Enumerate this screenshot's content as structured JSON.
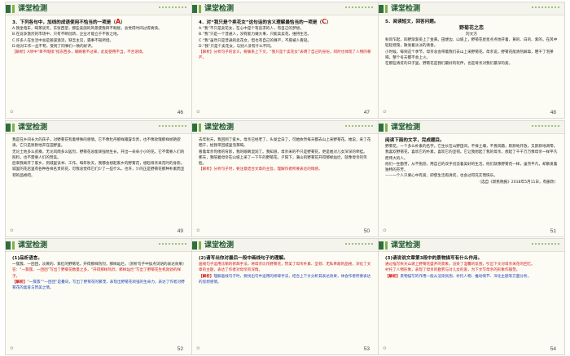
{
  "slides": [
    {
      "header": "课堂检测",
      "page": "46",
      "question": "3．下列各句中，加线的成语使用不恰当的一项是（",
      "answer": "A",
      "answer_close": "）",
      "lines": [
        "A.我坐电车，喝茶谈笑，东张西望，那些美丽的风景使我目不暇接，总觉得时间过得真快。",
        "B.在竞争激烈的市场中，只有不断创新，企业才能立于不败之地。",
        "C.许多人在生活中总是随波逐流，缺乏主见，遇事不知所措。",
        "D.他对工作一丝不苟，受到了同事们一致的好评。"
      ],
      "analysis_label": "【解析】",
      "analysis": "A项中“目不暇接”指东西多，眼睛看不过来，此处使用不当，不合语境。"
    },
    {
      "header": "课堂检测",
      "page": "47",
      "question": "4．对“我只是个卖花女”这句话的含义理解最恰当的一项是（",
      "answer": "C",
      "answer_close": "）",
      "lines": [
        "A.“我”不只是卖花女，在心中是个有追求的人，有自己的梦想。",
        "B.“我”只是一个普通人，没有能力做大事，只能卖卖花，维持生活。",
        "C.“我”虽然只是普通的卖花女，但也有自己的尊严，不愿被人看轻。",
        "D.“我”只是个卖花女，与别人没有什么不同。"
      ],
      "analysis_label": "【解析】",
      "analysis": "分析句子的含义，要联系上下文，“我只是个卖花女”表明了自己的身份，同时也体现了人物的尊严。"
    },
    {
      "header": "课堂检测",
      "page": "48",
      "question": "5．阅读短文，回答问题。",
      "story_title": "野菊花之恋",
      "story_author": "刘文方",
      "lines": [
        "秋风乍起，四野渐渐染上了金黄。田埂边、山坡上，野菊花星星点点地开着，黄的、白的、紫的，在风中轻轻摇曳，散发着淡淡的清香。",
        "小时候，每到这个季节，母亲总会带着我们去山上采野菊花。母亲说，野菊花能清热解毒，晒干了泡茶喝，整个冬天都不会上火。",
        "在那些清贫的日子里，野菊花是我们最好的玩伴，也是母亲对我们最深的爱。"
      ]
    },
    {
      "header": "课堂检测",
      "page": "49",
      "lines": [
        "我是在乡间长大的孩子，对野菊花有着特殊的感情。它不像牡丹那样雍容华贵，也不像玫瑰那样娇艳欲滴，它只是默默地开在田野里。",
        "无论土地多么贫瘠，无论风雨多么猛烈，野菊花总能顽强地生长，开出一朵朵小小的花。它不需要人们的照料，也不需要人们的赞美。",
        "后来我离开了家乡，到城里读书、工作。每年秋天，我都会想起家乡的野菊花，想起母亲采花时的身影。",
        "城里的花店里有各种各样名贵的花，可我总觉得它们少了一些什么。也许，少的正是野菊花那种朴素而坚韧的品格吧。"
      ]
    },
    {
      "header": "课堂检测",
      "page": "50",
      "lines": [
        "去年秋天，我回到了家乡。母亲已经老了，头发全白了，可她依然每天都去山上采野菊花。她说，采了花晒干，给我带回城里泡茶喝。",
        "看着母亲佝偻的背影，我的眼睛湿润了。我知道，母亲采的不只是野菊花，更是她对儿女深深的牵挂。",
        "那天，我陪着母亲在山坡上采了一下午的野菊花。夕阳下，满山的野菊花开得那样灿烂，就像母亲的笑脸。"
      ],
      "analysis_label": "【解析】",
      "analysis": "分析句子时，要注意结合文章的主旨，理解作者所要表达的情感。"
    },
    {
      "header": "课堂检测",
      "page": "51",
      "heading": "阅读下面的文字，完成题目。",
      "lines": [
        "野菊花，一个多么朴素的名字。它生长在山野田间，不择土壤，不畏风霜，默默地开放，又默默地凋零。",
        "我喜欢野菊花，喜欢它的朴素，喜欢它的坚韧。它让我想起了我的母亲，想起了千千万万像母亲一样平凡而伟大的人。",
        "他们一生勤劳，从不抱怨，用自己的双手创造着美好的生活。他们就像野菊花一样，虽然平凡，却散发着独特的芬芳。",
        "——一个人只要心中有爱，即使生活再清贫，也会过得充实而快乐。"
      ],
      "source": "（选自《新民晚报》2018年5月11日，有删改）"
    },
    {
      "header": "课堂检测",
      "page": "52",
      "heading": "(1)品析语言。",
      "lines": [
        "一簇簇、一团团，淡黄的、紫红的野菊花，开得那样热烈，那样灿烂。（赏析句子中加点词语的表达效果）",
        "答：“一簇簇、一团团”写出了野菊花数量之多，“开得那样热烈，那样灿烂”写出了野菊花生机勃勃的样子。"
      ],
      "analysis_label": "【解析】",
      "analysis": "“一簇簇”“一团团”是叠词，写出了野菊花的繁茂，表现出野菊花顽强的生命力，表达了作者对野菊花的喜爱与赞美之情。"
    },
    {
      "header": "课堂检测",
      "page": "53",
      "heading": "(2)请写出你对最后一段中画线句子的理解。",
      "lines": [
        "画线句子运用比喻的修辞手法，将母亲比作野菊花，赞美了母亲朴素、坚韧、无私奉献的品格，深化了文章的主题，表达了作者对母亲的深情。"
      ],
      "analysis_label": "【解析】",
      "analysis": "理解画线句子时，要找出句中运用的修辞手法，结合上下文分析其表达效果，体会作者所要表达的思想感情。"
    },
    {
      "header": "课堂检测",
      "page": "54",
      "heading": "(3)请说说文章第3段中的景物描写有什么作用。",
      "lines": [
        "通过描写秋天山坡上野菊花盛开的景象，渲染了温馨的氛围，引出下文对母亲采花的回忆。",
        "衬托了人物形象，表现了母亲的勤劳与对儿女的爱，为下文写母亲的形象作铺垫。"
      ],
      "analysis_label": "【解析】",
      "analysis": "景物描写的作用一般从渲染氛围、衬托人物、推动情节、深化主题等方面分析。"
    }
  ],
  "colors": {
    "accent_green": "#2f6f3a",
    "light_green": "#7cb34a",
    "answer_red": "#d11515",
    "blue_text": "#1b3fb3"
  }
}
